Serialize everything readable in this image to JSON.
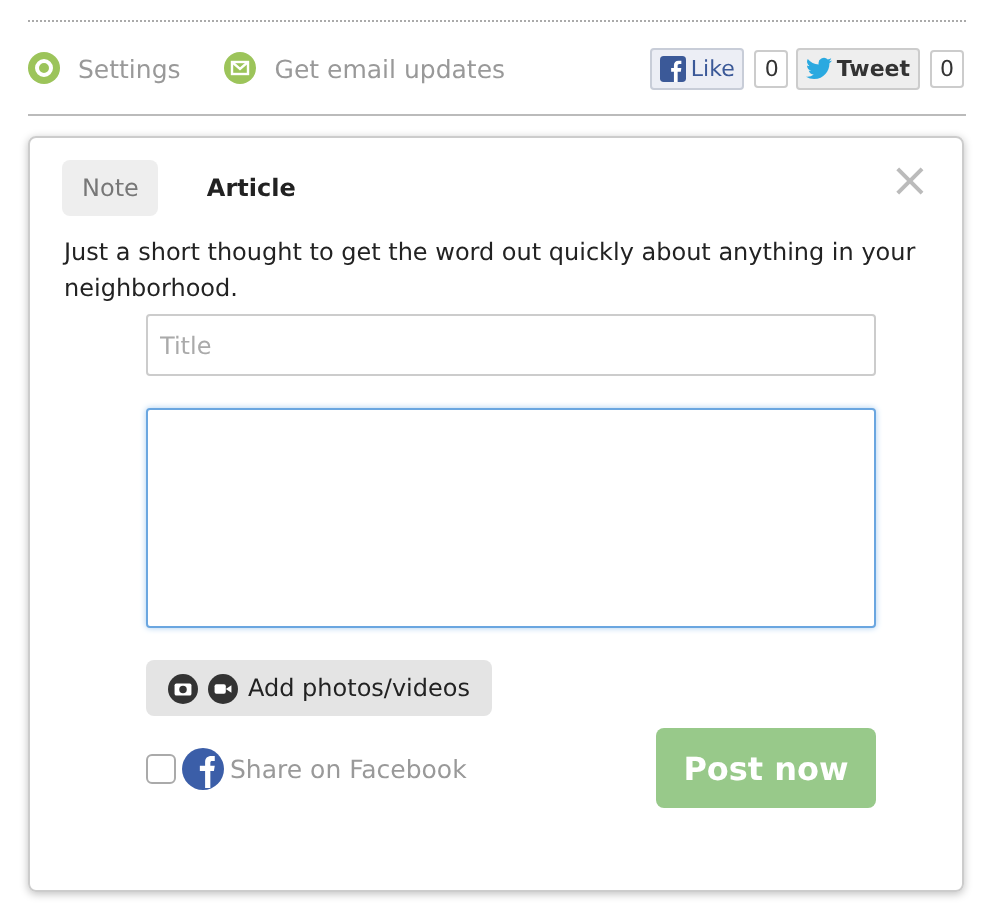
{
  "toolbar": {
    "links": [
      {
        "kind": "settings",
        "label": "Settings"
      },
      {
        "kind": "email",
        "label": "Get email updates"
      }
    ],
    "social": [
      {
        "kind": "facebook",
        "label": "Like",
        "count": "0"
      },
      {
        "kind": "twitter",
        "label": "Tweet",
        "count": "0"
      }
    ]
  },
  "composer": {
    "tabs": [
      {
        "label": "Note",
        "selected": false
      },
      {
        "label": "Article",
        "selected": true
      }
    ],
    "close": "×",
    "description": "Just a short thought to get the word out quickly about anything in your neighborhood.",
    "title_field": {
      "placeholder": "Title"
    },
    "media_button": "Add photos/videos",
    "share": {
      "label": "Share on Facebook",
      "checked": false
    },
    "post_button": {
      "label": "Post now",
      "disabled": true
    }
  }
}
